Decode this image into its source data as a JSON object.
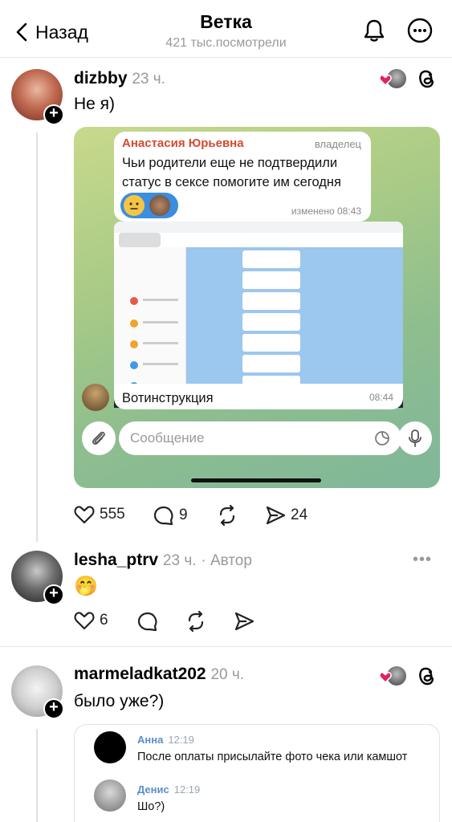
{
  "header": {
    "back_label": "Назад",
    "title": "Ветка",
    "views": "421 тыс.посмотрели"
  },
  "posts": [
    {
      "username": "dizbby",
      "time": "23 ч.",
      "text": "Не я)",
      "media": {
        "owner_name": "Анастасия Юрьевна",
        "owner_badge": "владелец",
        "message": "Чьи родители еще не подтвердили статус в сексе помогите им сегодня",
        "edited": "изменено 08:43",
        "caption": "Вотинструкция",
        "caption_time": "08:44",
        "input_placeholder": "Сообщение"
      },
      "likes": "555",
      "comments": "9",
      "shares": "24"
    },
    {
      "username": "lesha_ptrv",
      "time": "23 ч.",
      "author_tag": "· Автор",
      "text": "🤭",
      "likes": "6"
    },
    {
      "username": "marmeladkat202",
      "time": "20 ч.",
      "text": "было уже?)",
      "quote": [
        {
          "name": "Анна",
          "time": "12:19",
          "text": "После оплаты присылайте фото чека или камшот"
        },
        {
          "name": "Денис",
          "time": "12:19",
          "text": "Шо?)"
        }
      ]
    }
  ],
  "colors": {
    "muted": "#999999",
    "like_heart": "#e0245e",
    "telegram_accent": "#3b8de0",
    "tg_name": "#d34a2f"
  }
}
